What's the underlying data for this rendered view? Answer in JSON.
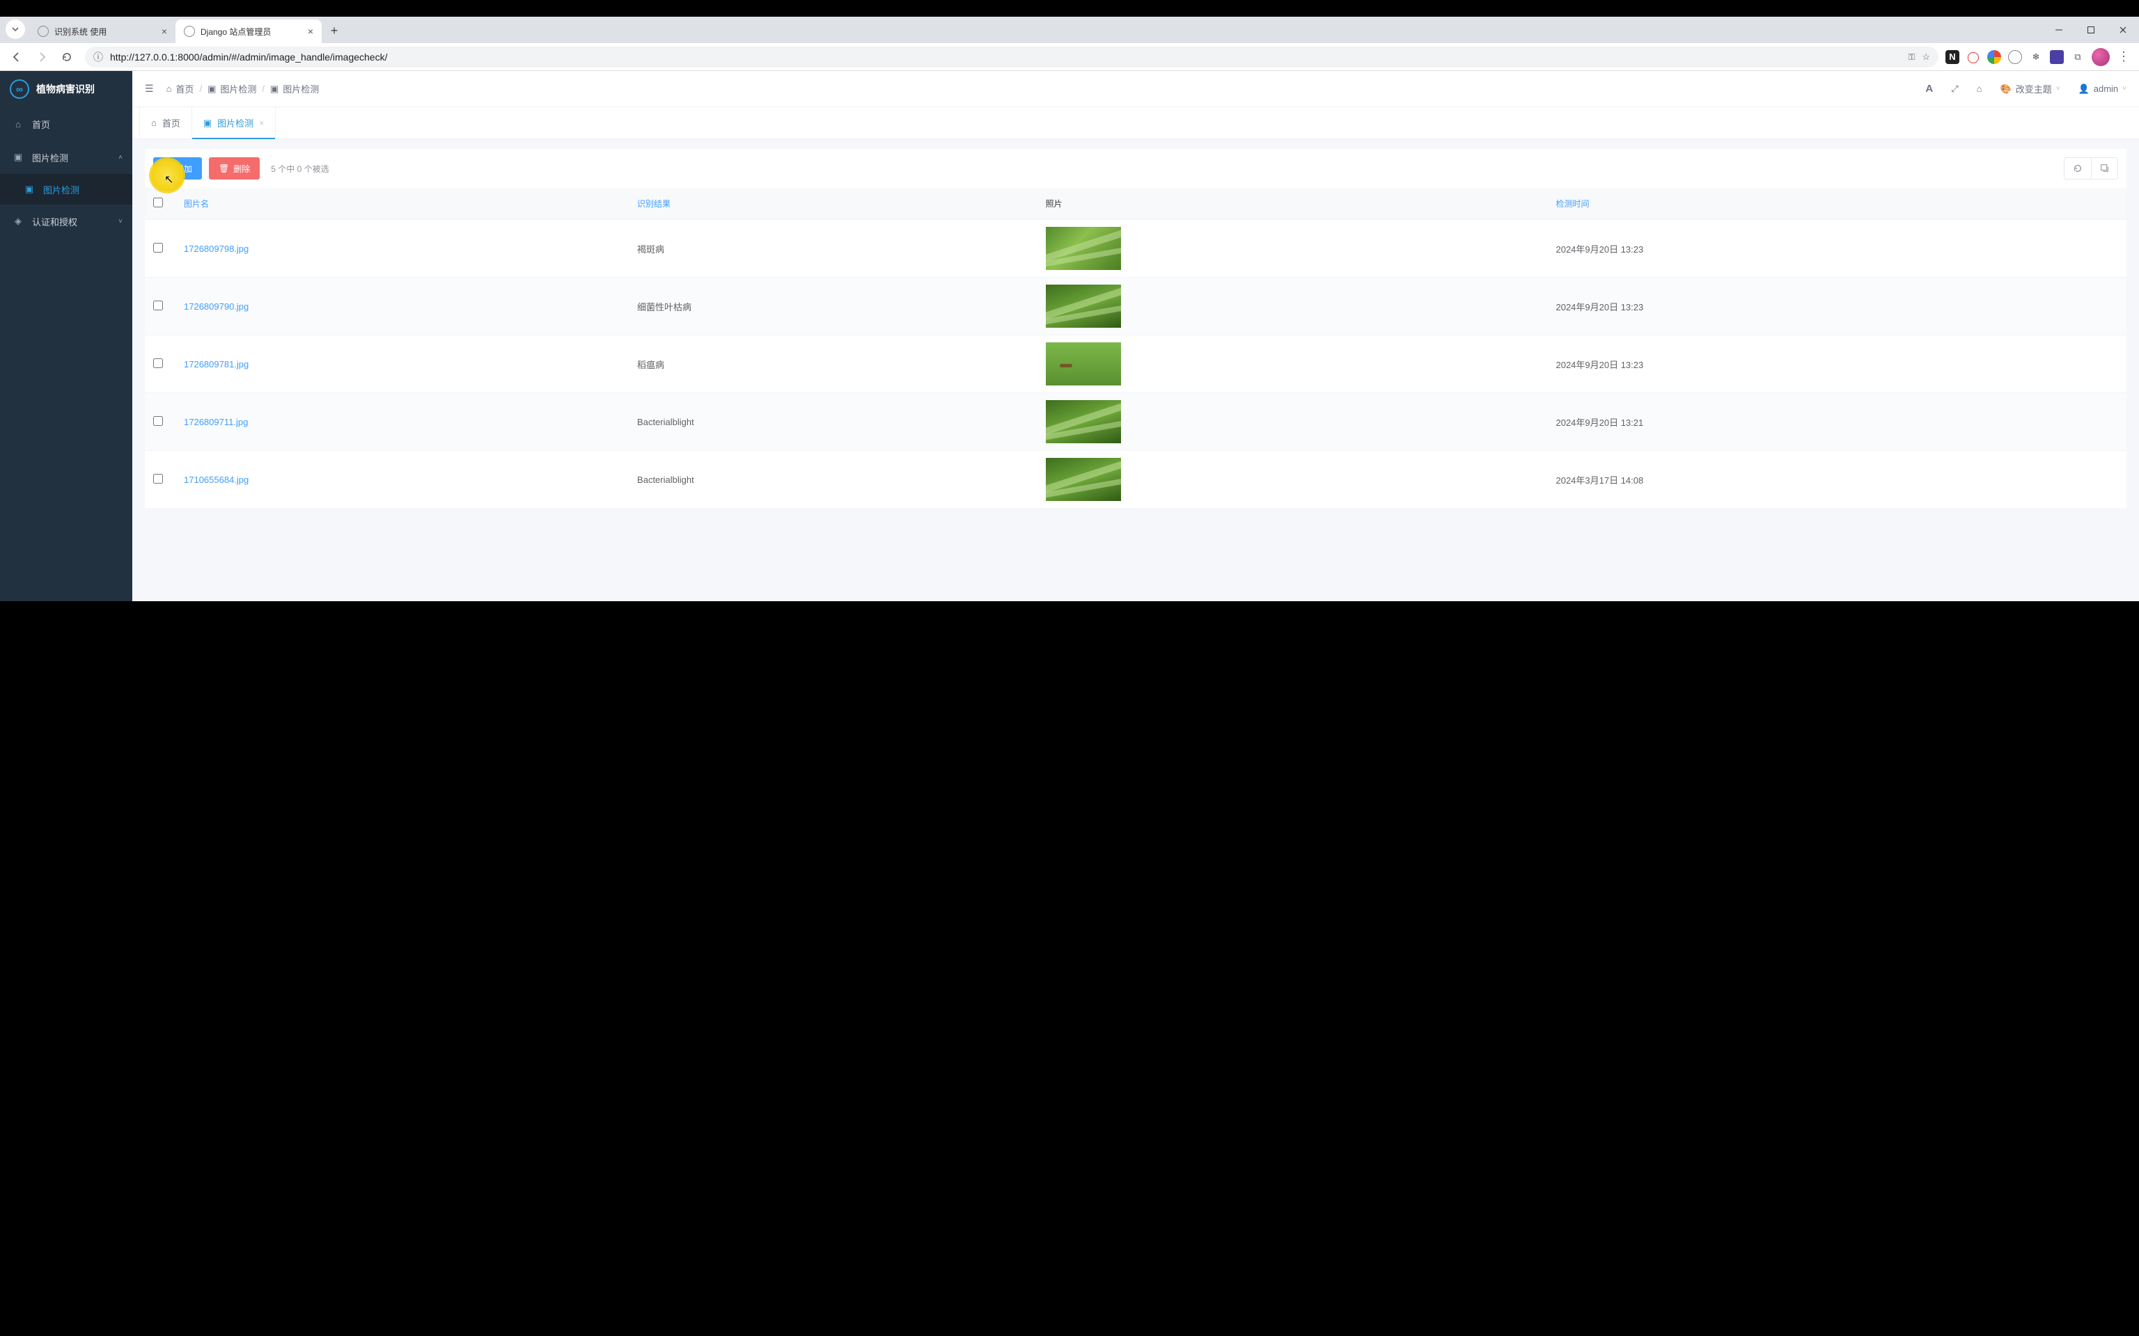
{
  "browser": {
    "tabs": [
      {
        "title": "识别系统 使用",
        "active": false
      },
      {
        "title": "Django 站点管理员",
        "active": true
      }
    ],
    "url": "http://127.0.0.1:8000/admin/#/admin/image_handle/imagecheck/"
  },
  "sidebar": {
    "brand": "植物病害识别",
    "items": {
      "home": "首页",
      "image_detect": "图片检测",
      "image_detect_sub": "图片检测",
      "auth": "认证和授权"
    }
  },
  "topbar": {
    "breadcrumbs": {
      "home": "首页",
      "group": "图片检测",
      "page": "图片检测"
    },
    "theme_label": "改变主题",
    "user": "admin"
  },
  "pagetabs": {
    "home": "首页",
    "detect": "图片检测"
  },
  "toolbar": {
    "add": "增加",
    "del": "删除",
    "selection": "5 个中 0 个被选"
  },
  "table": {
    "headers": {
      "name": "图片名",
      "result": "识别结果",
      "photo": "照片",
      "time": "检测时间"
    },
    "rows": [
      {
        "name": "1726809798.jpg",
        "result": "褐斑病",
        "time": "2024年9月20日 13:23",
        "thumb": "var1"
      },
      {
        "name": "1726809790.jpg",
        "result": "细菌性叶枯病",
        "time": "2024年9月20日 13:23",
        "thumb": "var2"
      },
      {
        "name": "1726809781.jpg",
        "result": "稻瘟病",
        "time": "2024年9月20日 13:23",
        "thumb": "var3"
      },
      {
        "name": "1726809711.jpg",
        "result": "Bacterialblight",
        "time": "2024年9月20日 13:21",
        "thumb": "var2"
      },
      {
        "name": "1710655684.jpg",
        "result": "Bacterialblight",
        "time": "2024年3月17日 14:08",
        "thumb": "var2"
      }
    ]
  }
}
